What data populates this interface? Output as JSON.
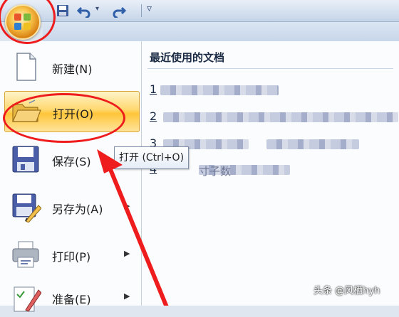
{
  "menu": {
    "items": [
      {
        "label": "新建(N)",
        "icon": "new-document-icon"
      },
      {
        "label": "打开(O)",
        "icon": "open-folder-icon",
        "selected": true
      },
      {
        "label": "保存(S)",
        "icon": "save-disk-icon"
      },
      {
        "label": "另存为(A)",
        "icon": "save-as-icon",
        "has_submenu": true
      },
      {
        "label": "打印(P)",
        "icon": "printer-icon",
        "has_submenu": true
      },
      {
        "label": "准备(E)",
        "icon": "prepare-icon",
        "has_submenu": true
      }
    ]
  },
  "recent": {
    "title": "最近使用的文档",
    "rows": [
      {
        "num": "1",
        "tail": ""
      },
      {
        "num": "2",
        "tail": ""
      },
      {
        "num": "3",
        "tail": ""
      },
      {
        "num": "4",
        "tail": "寸子数"
      }
    ]
  },
  "tooltip": {
    "text": "打开 (Ctrl+O)"
  },
  "watermark": "头条 @风栖hyh",
  "colors": {
    "highlight": "#ee1c1c",
    "selection": "#ffd870"
  }
}
